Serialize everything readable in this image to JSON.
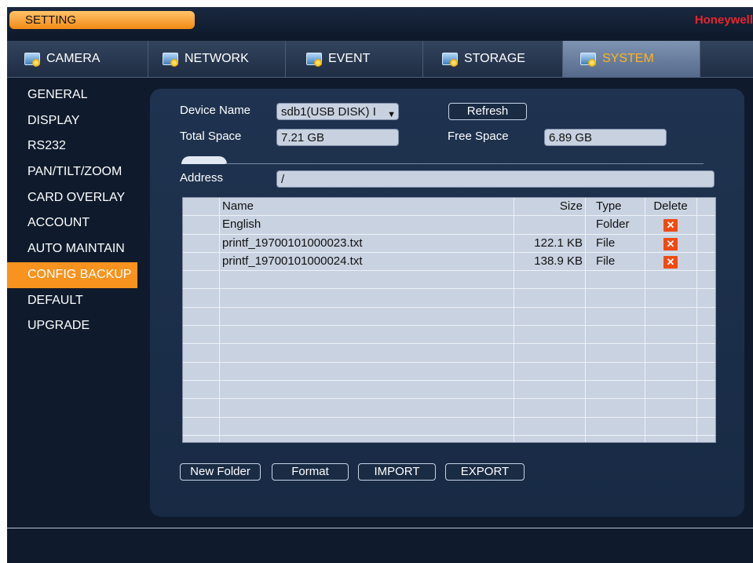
{
  "header": {
    "setting_title": "SETTING",
    "brand": "Honeywell"
  },
  "tabs": [
    {
      "label": "CAMERA",
      "icon": "camera-icon",
      "active": false
    },
    {
      "label": "NETWORK",
      "icon": "network-icon",
      "active": false
    },
    {
      "label": "EVENT",
      "icon": "event-icon",
      "active": false
    },
    {
      "label": "STORAGE",
      "icon": "storage-icon",
      "active": false
    },
    {
      "label": "SYSTEM",
      "icon": "system-icon",
      "active": true
    }
  ],
  "sidebar": {
    "items": [
      {
        "label": "GENERAL"
      },
      {
        "label": "DISPLAY"
      },
      {
        "label": "RS232"
      },
      {
        "label": "PAN/TILT/ZOOM"
      },
      {
        "label": "CARD OVERLAY"
      },
      {
        "label": "ACCOUNT"
      },
      {
        "label": "AUTO MAINTAIN"
      },
      {
        "label": "CONFIG BACKUP",
        "active": true
      },
      {
        "label": "DEFAULT"
      },
      {
        "label": "UPGRADE"
      }
    ]
  },
  "form": {
    "device_name_label": "Device Name",
    "device_name_value": "sdb1(USB DISK) I",
    "refresh_label": "Refresh",
    "total_space_label": "Total Space",
    "total_space_value": "7.21 GB",
    "free_space_label": "Free Space",
    "free_space_value": "6.89 GB",
    "address_label": "Address",
    "address_value": "/"
  },
  "table": {
    "headers": {
      "name": "Name",
      "size": "Size",
      "type": "Type",
      "delete": "Delete"
    },
    "rows": [
      {
        "name": "English",
        "size": "",
        "type": "Folder",
        "delete": "✕"
      },
      {
        "name": "printf_19700101000023.txt",
        "size": "122.1 KB",
        "type": "File",
        "delete": "✕"
      },
      {
        "name": "printf_19700101000024.txt",
        "size": "138.9 KB",
        "type": "File",
        "delete": "✕"
      }
    ]
  },
  "actions": {
    "new_folder": "New Folder",
    "format": "Format",
    "import": "IMPORT",
    "export": "EXPORT"
  },
  "colors": {
    "accent": "#f7931e",
    "active_tab_text": "#ffb321",
    "brand": "#e5262e",
    "background": "#0f1b2d"
  }
}
